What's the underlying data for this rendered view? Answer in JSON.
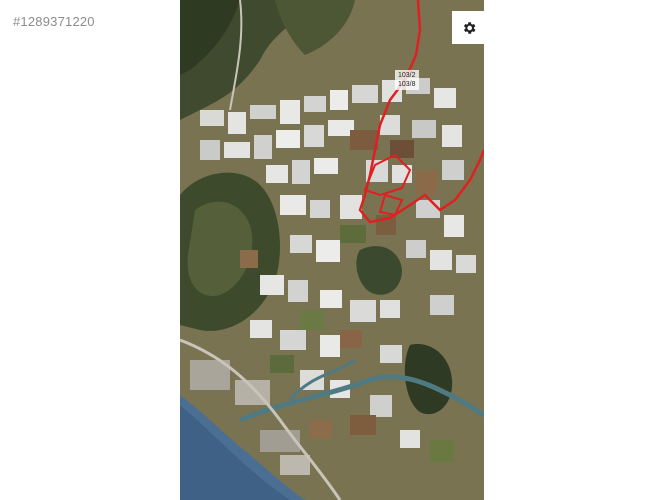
{
  "listing": {
    "id_text": "#1289371220"
  },
  "map": {
    "view": "satellite",
    "parcel_labels": [
      "103/2",
      "103/8"
    ],
    "parcel_boundary_color": "#e02020",
    "settings_icon": "gear-icon"
  }
}
